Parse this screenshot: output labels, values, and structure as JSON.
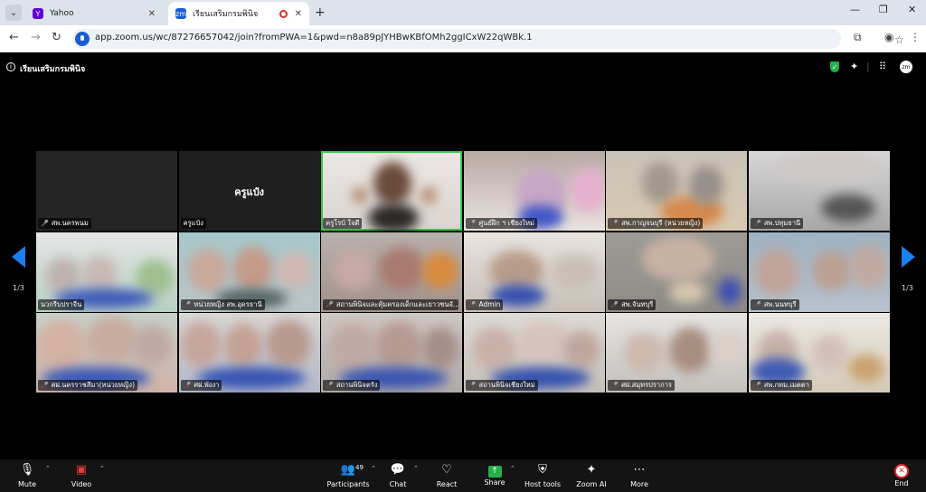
{
  "browser": {
    "tabs": [
      {
        "title": "Yahoo",
        "favicon": "yahoo-icon",
        "color": "#6001d2"
      },
      {
        "title": "เรียนเสริมกรมพินิจ",
        "favicon": "zoom-icon",
        "color": "#1a5bd6",
        "recording": true
      }
    ],
    "url": "app.zoom.us/wc/87276657042/join?fromPWA=1&pwd=n8a89pJYHBwKBfOMh2ggICxW22qWBk.1"
  },
  "meeting": {
    "title": "เรียนเสริมกรมพินิจ",
    "page_indicator_left": "1/3",
    "page_indicator_right": "1/3"
  },
  "participants": [
    {
      "name": "สพ.นครพนม",
      "muted": true,
      "kind": "video",
      "scene": "blank"
    },
    {
      "name": "ครูแป๋ง",
      "muted": false,
      "kind": "novideo",
      "display": "ครูแป๋ง"
    },
    {
      "name": "ครูโรบ์ ใจดี",
      "muted": false,
      "kind": "video",
      "speaking": true,
      "scene": "teacher"
    },
    {
      "name": "ศูนย์ฝึก ฯ เชียงใหม่",
      "muted": true,
      "kind": "video",
      "scene": "classroom"
    },
    {
      "name": "สพ.กาญจนบุรี (หน่วยหญิง)",
      "muted": true,
      "kind": "video",
      "scene": "classroom2"
    },
    {
      "name": "สพ.ปทุมธานี",
      "muted": true,
      "kind": "video",
      "scene": "hall"
    },
    {
      "name": "นวกรีบปราจีน",
      "muted": false,
      "kind": "video",
      "scene": "group"
    },
    {
      "name": "หน่วยหญิง สพ.อุดรธานี",
      "muted": true,
      "kind": "video",
      "scene": "group2"
    },
    {
      "name": "สถานพินิจและคุ้มครองเด็กและเยาวชนจั...",
      "muted": true,
      "kind": "video",
      "scene": "group3"
    },
    {
      "name": "Admin",
      "muted": true,
      "kind": "video",
      "scene": "room"
    },
    {
      "name": "สพ.จันทบุรี",
      "muted": true,
      "kind": "video",
      "scene": "table"
    },
    {
      "name": "สพ.นนทบุรี",
      "muted": true,
      "kind": "video",
      "scene": "group4"
    },
    {
      "name": "ศฝ.นครราชสีมา(หน่วยหญิง)",
      "muted": true,
      "kind": "video",
      "scene": "group5"
    },
    {
      "name": "ศฝ.พังงา",
      "muted": true,
      "kind": "video",
      "scene": "group6"
    },
    {
      "name": "สถานพินิจตรัง",
      "muted": true,
      "kind": "video",
      "scene": "group7"
    },
    {
      "name": "สถานพินิจเชียงใหม่",
      "muted": true,
      "kind": "video",
      "scene": "group8"
    },
    {
      "name": "ศฝ.สมุทรปราการ",
      "muted": true,
      "kind": "video",
      "scene": "group9"
    },
    {
      "name": "สพ.กทม.เมตตา",
      "muted": true,
      "kind": "video",
      "scene": "group10"
    }
  ],
  "toolbar": {
    "mute": "Mute",
    "video": "Video",
    "participants": "Participants",
    "participants_count": "49",
    "chat": "Chat",
    "react": "React",
    "share": "Share",
    "host_tools": "Host tools",
    "zoom_ai": "Zoom AI",
    "more": "More",
    "end": "End"
  }
}
